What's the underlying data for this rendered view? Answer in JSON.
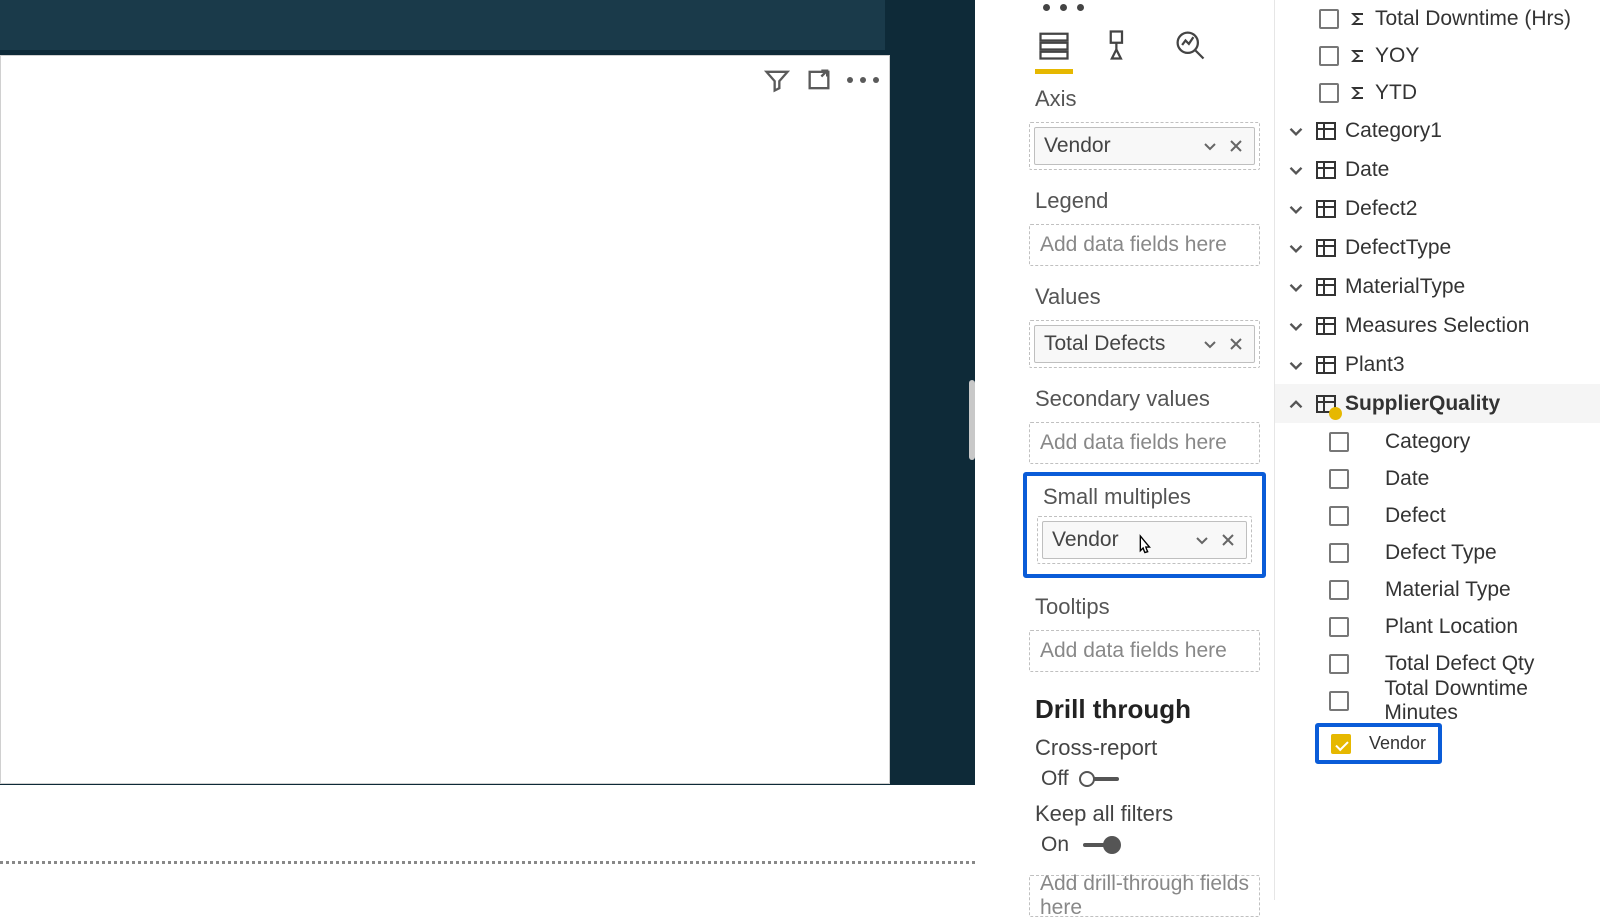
{
  "vizPanel": {
    "wells": {
      "axis": {
        "label": "Axis",
        "chip": "Vendor"
      },
      "legend": {
        "label": "Legend",
        "placeholder": "Add data fields here"
      },
      "values": {
        "label": "Values",
        "chip": "Total Defects"
      },
      "secondaryValues": {
        "label": "Secondary values",
        "placeholder": "Add data fields here"
      },
      "smallMultiples": {
        "label": "Small multiples",
        "chip": "Vendor"
      },
      "tooltips": {
        "label": "Tooltips",
        "placeholder": "Add data fields here"
      }
    },
    "drillThrough": {
      "title": "Drill through",
      "crossReport": {
        "label": "Cross-report",
        "stateLabel": "Off"
      },
      "keepAllFilters": {
        "label": "Keep all filters",
        "stateLabel": "On"
      },
      "placeholder": "Add drill-through fields here"
    }
  },
  "fieldsPanel": {
    "topFields": [
      {
        "label": "Total Downtime (Hrs)",
        "checked": false,
        "sigma": true
      },
      {
        "label": "YOY",
        "checked": false,
        "sigma": true
      },
      {
        "label": "YTD",
        "checked": false,
        "sigma": true
      }
    ],
    "tables": [
      {
        "name": "Category1",
        "expanded": false
      },
      {
        "name": "Date",
        "expanded": false
      },
      {
        "name": "Defect2",
        "expanded": false
      },
      {
        "name": "DefectType",
        "expanded": false
      },
      {
        "name": "MaterialType",
        "expanded": false
      },
      {
        "name": "Measures Selection",
        "expanded": false
      },
      {
        "name": "Plant3",
        "expanded": false
      }
    ],
    "expandedTable": {
      "name": "SupplierQuality",
      "fields": [
        {
          "label": "Category",
          "checked": false
        },
        {
          "label": "Date",
          "checked": false
        },
        {
          "label": "Defect",
          "checked": false
        },
        {
          "label": "Defect Type",
          "checked": false
        },
        {
          "label": "Material Type",
          "checked": false
        },
        {
          "label": "Plant Location",
          "checked": false
        },
        {
          "label": "Total Defect Qty",
          "checked": false
        },
        {
          "label": "Total Downtime Minutes",
          "checked": false
        },
        {
          "label": "Vendor",
          "checked": true,
          "highlighted": true
        }
      ]
    }
  }
}
